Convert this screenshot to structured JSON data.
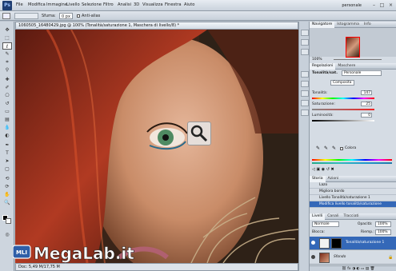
{
  "menubar": {
    "logo": "Ps",
    "items": [
      "File",
      "Modifica",
      "Immagine",
      "Livello",
      "Selezione",
      "Filtro",
      "Analisi",
      "3D",
      "Visualizza",
      "Finestra",
      "Aiuto"
    ],
    "workspace": "personale",
    "win_buttons": [
      "–",
      "□",
      "×"
    ]
  },
  "options": {
    "sfuma_label": "Sfuma:",
    "sfuma_value": "0 px",
    "antialias": "Anti-alias"
  },
  "document": {
    "tab_title": "1060505_16480429.jpg @ 100% (Tonalità/saturazione 1, Maschera di livello/8) *",
    "status": "Doc: 5,49 M/17,75 M"
  },
  "navigator": {
    "tabs": [
      "Navigatore",
      "Istogramma",
      "Info"
    ],
    "zoom": "100%"
  },
  "adjustments": {
    "tabs": [
      "Regolazioni",
      "Maschere"
    ],
    "title": "Tonalità/sat.",
    "preset": "Personale",
    "channel": "Composita",
    "hue_label": "Tonalità:",
    "hue_value": "147",
    "sat_label": "Saturazione:",
    "sat_value": "25",
    "light_label": "Luminosità:",
    "light_value": "0",
    "colorize_label": "Colora"
  },
  "history": {
    "tabs": [
      "Storia",
      "Azioni"
    ],
    "items": [
      "Lazo",
      "Migliora bordo",
      "Livello Tonalità/saturazione 1",
      "Modifica livello tonalità/saturazione"
    ]
  },
  "layers": {
    "tabs": [
      "Livelli",
      "Canali",
      "Tracciati"
    ],
    "blend": "Normale",
    "opacity_label": "Opacità:",
    "opacity_value": "100%",
    "lock_label": "Blocca:",
    "fill_label": "Riemp.:",
    "fill_value": "100%",
    "items": [
      {
        "name": "Tonalità/saturazione 1"
      },
      {
        "name": "Sfondo"
      }
    ]
  },
  "watermark": {
    "text": "MegaLab.it",
    "badge": "MLI"
  },
  "colors": {
    "accent": "#3468b8",
    "watermark": "#ffffff"
  }
}
